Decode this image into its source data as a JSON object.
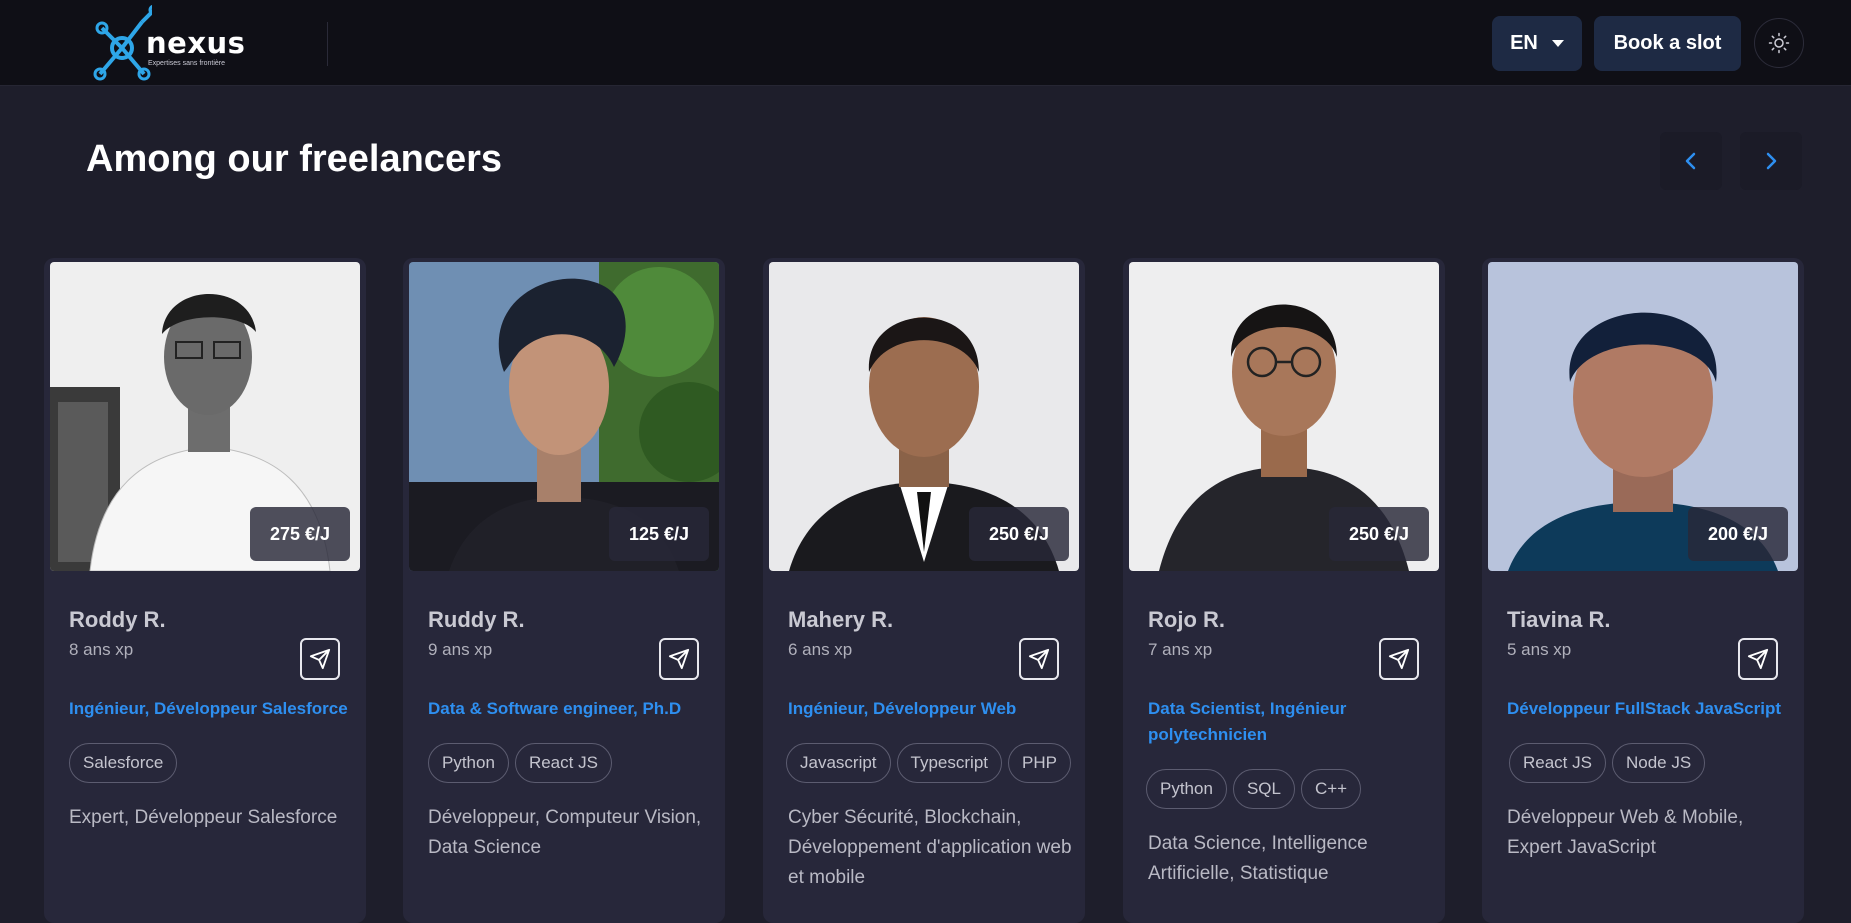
{
  "header": {
    "logo_word": "nexus",
    "logo_tagline": "Expertises sans frontière",
    "lang_label": "EN",
    "book_label": "Book a slot"
  },
  "section": {
    "title": "Among our freelancers"
  },
  "colors": {
    "background": "#1e1e2b",
    "card": "#27273a",
    "accent_blue": "#2e8ff0",
    "header": "#0f0f16",
    "button": "#1e2a44"
  },
  "cards": [
    {
      "name": "Roddy R.",
      "experience": "8 ans xp",
      "rate": "275 €/J",
      "role": "Ingénieur, Développeur Salesforce",
      "tags": [
        "Salesforce"
      ],
      "description": "Expert, Développeur Salesforce"
    },
    {
      "name": "Ruddy R.",
      "experience": "9 ans xp",
      "rate": "125 €/J",
      "role": "Data & Software engineer, Ph.D",
      "tags": [
        "Python",
        "React JS"
      ],
      "description": "Développeur, Computeur Vision, Data Science"
    },
    {
      "name": "Mahery R.",
      "experience": "6 ans xp",
      "rate": "250 €/J",
      "role": "Ingénieur, Développeur Web",
      "tags": [
        "Javascript",
        "Typescript",
        "PHP"
      ],
      "description": "Cyber Sécurité, Blockchain, Développement d'application web et mobile"
    },
    {
      "name": "Rojo R.",
      "experience": "7 ans xp",
      "rate": "250 €/J",
      "role": "Data Scientist, Ingénieur polytechnicien",
      "tags": [
        "Python",
        "SQL",
        "C++"
      ],
      "description": "Data Science, Intelligence Artificielle, Statistique"
    },
    {
      "name": "Tiavina R.",
      "experience": "5 ans xp",
      "rate": "200 €/J",
      "role": "Développeur FullStack JavaScript",
      "tags": [
        "React JS",
        "Node JS"
      ],
      "description": "Développeur Web & Mobile, Expert JavaScript"
    }
  ]
}
